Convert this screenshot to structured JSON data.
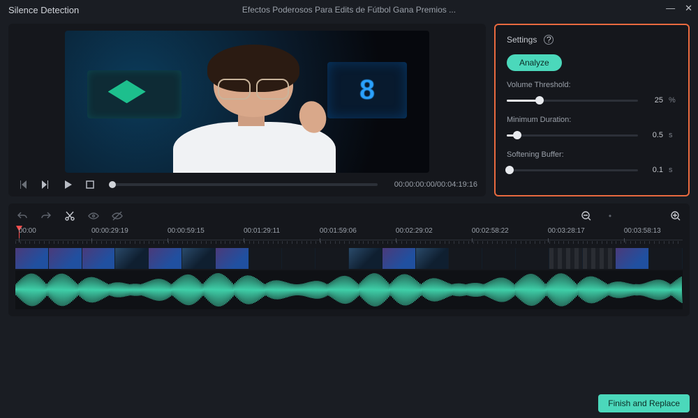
{
  "titlebar": {
    "title": "Silence Detection",
    "subtitle": "Efectos Poderosos Para Edits de Fútbol   Gana Premios ..."
  },
  "preview": {
    "timecode": "00:00:00:00/00:04:19:16"
  },
  "settings": {
    "heading": "Settings",
    "analyze_label": "Analyze",
    "volume_threshold": {
      "label": "Volume Threshold:",
      "value": "25",
      "unit": "%",
      "pct": 25
    },
    "min_duration": {
      "label": "Minimum Duration:",
      "value": "0.5",
      "unit": "s",
      "pct": 8
    },
    "soft_buffer": {
      "label": "Softening Buffer:",
      "value": "0.1",
      "unit": "s",
      "pct": 2
    }
  },
  "ruler": {
    "ticks": [
      {
        "label": "00:00",
        "pct": 0.5
      },
      {
        "label": "00:00:29:19",
        "pct": 11.4
      },
      {
        "label": "00:00:59:15",
        "pct": 22.8
      },
      {
        "label": "00:01:29:11",
        "pct": 34.2
      },
      {
        "label": "00:01:59:06",
        "pct": 45.6
      },
      {
        "label": "00:02:29:02",
        "pct": 57.0
      },
      {
        "label": "00:02:58:22",
        "pct": 68.4
      },
      {
        "label": "00:03:28:17",
        "pct": 79.8
      },
      {
        "label": "00:03:58:13",
        "pct": 91.2
      }
    ]
  },
  "footer": {
    "finish_label": "Finish and Replace"
  }
}
